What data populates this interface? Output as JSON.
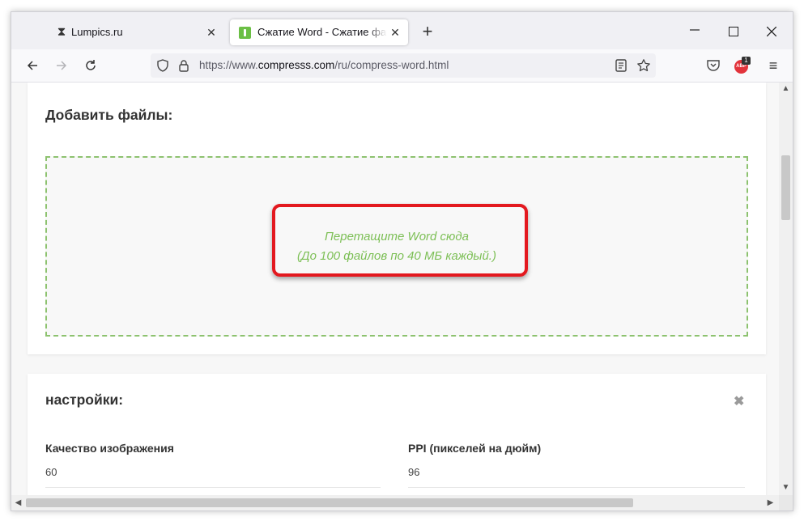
{
  "browser": {
    "tabs": [
      {
        "title": "Lumpics.ru",
        "icon": "hourglass-icon",
        "active": false
      },
      {
        "title": "Сжатие Word - Сжатие файлов",
        "icon": "compresss-favicon-icon",
        "active": true
      }
    ],
    "new_tab_symbol": "+",
    "close_symbol": "✕",
    "url_prefix": "https://www.",
    "url_host": "compresss.com",
    "url_path": "/ru/compress-word.html",
    "extension_badge": "1",
    "extension_label": "ABP"
  },
  "page": {
    "add_files_title": "Добавить файлы:",
    "drop_line1": "Перетащите Word сюда",
    "drop_line2": "(До 100 файлов по 40 МБ каждый.)",
    "settings_title": "настройки:",
    "settings_close": "✖",
    "image_quality_label": "Качество изображения",
    "image_quality_value": "60",
    "ppi_label": "PPI (пикселей на дюйм)",
    "ppi_value": "96"
  },
  "colors": {
    "accent_green": "#7cbf55",
    "dash_border": "#8dc26f",
    "highlight_red": "#e3191f"
  }
}
